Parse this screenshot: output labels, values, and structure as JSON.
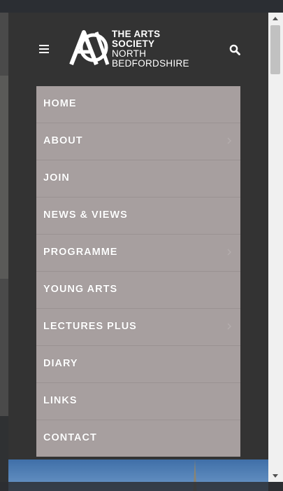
{
  "header": {
    "logo": {
      "line1": "THE ARTS",
      "line2": "SOCIETY",
      "line3": "NORTH",
      "line4": "BEDFORDSHIRE"
    },
    "menu_icon": "hamburger-icon",
    "search_icon": "search-icon"
  },
  "menu": {
    "items": [
      {
        "label": "HOME",
        "has_submenu": false
      },
      {
        "label": "ABOUT",
        "has_submenu": true
      },
      {
        "label": "JOIN",
        "has_submenu": false
      },
      {
        "label": "NEWS & VIEWS",
        "has_submenu": false
      },
      {
        "label": "PROGRAMME",
        "has_submenu": true
      },
      {
        "label": "YOUNG ARTS",
        "has_submenu": false
      },
      {
        "label": "LECTURES PLUS",
        "has_submenu": true
      },
      {
        "label": "DIARY",
        "has_submenu": false
      },
      {
        "label": "LINKS",
        "has_submenu": false
      },
      {
        "label": "CONTACT",
        "has_submenu": false
      }
    ]
  },
  "colors": {
    "panel_bg": "#333333",
    "menu_bg": "#a79f9f",
    "text": "#ffffff"
  }
}
